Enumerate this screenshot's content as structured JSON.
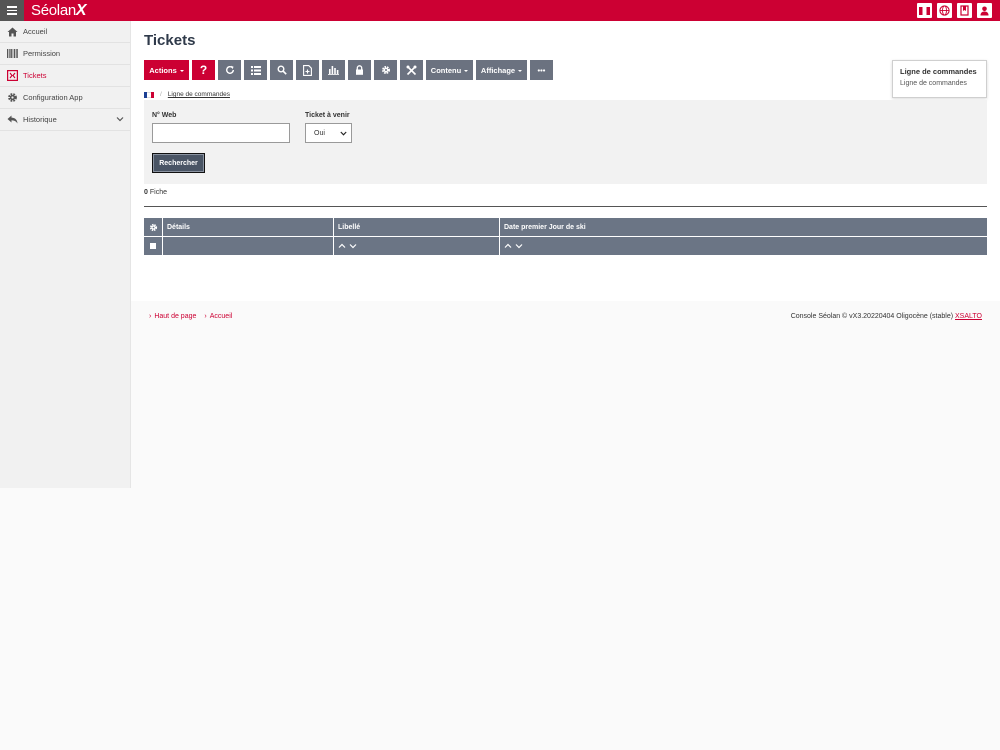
{
  "app": {
    "brand_prefix": "Séolan",
    "brand_suffix": "X"
  },
  "sidebar": {
    "items": [
      {
        "label": "Accueil",
        "icon": "home-icon"
      },
      {
        "label": "Permission",
        "icon": "barcode-icon"
      },
      {
        "label": "Tickets",
        "icon": "tickets-icon",
        "active": true
      },
      {
        "label": "Configuration App",
        "icon": "gear-icon"
      },
      {
        "label": "Historique",
        "icon": "reply-icon",
        "expandable": true
      }
    ]
  },
  "page": {
    "title": "Tickets"
  },
  "toolbar": {
    "actions_label": "Actions",
    "help_label": "?",
    "contenu_label": "Contenu",
    "affichage_label": "Affichage",
    "more_label": "•••"
  },
  "popup": {
    "title": "Ligne de commandes",
    "subtitle": "Ligne de commandes"
  },
  "breadcrumb": {
    "link": "Ligne de commandes",
    "separator": "/"
  },
  "search": {
    "web_label": "N° Web",
    "web_value": "",
    "ticket_label": "Ticket à venir",
    "ticket_value": "Oui",
    "submit_label": "Rechercher"
  },
  "results": {
    "count": "0",
    "count_label": "Fiche"
  },
  "table": {
    "columns": [
      "Détails",
      "Libellé",
      "Date premier Jour de ski"
    ]
  },
  "footer": {
    "top_link": "Haut de page",
    "home_link": "Accueil",
    "version_text": "Console Séolan © vX3.20220404 Oligocène (stable)",
    "company_link": "XSALTO"
  },
  "colors": {
    "brand": "#cc0033",
    "toolbar_grey": "#6b7280",
    "title": "#2f3a4a"
  }
}
